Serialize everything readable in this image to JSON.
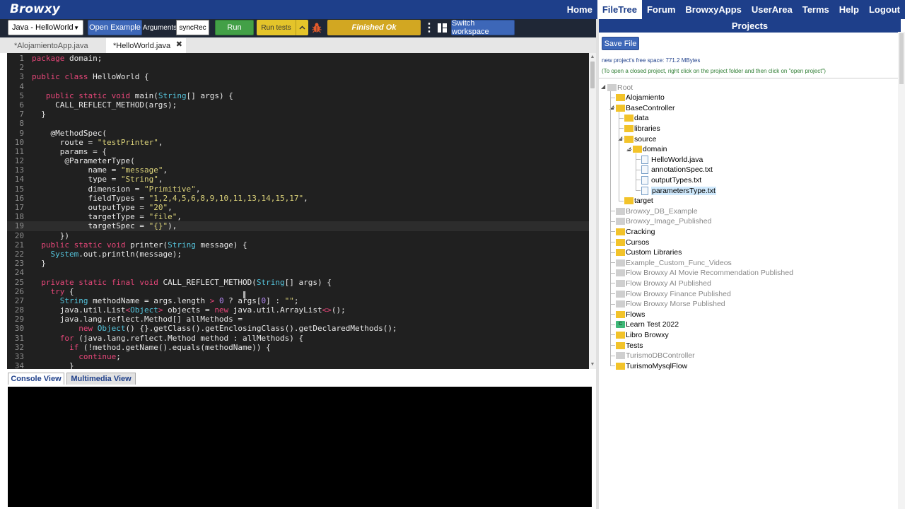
{
  "app": {
    "brand": "Browxy"
  },
  "nav": [
    "Home",
    "FileTree",
    "Forum",
    "BrowxyApps",
    "UserArea",
    "Terms",
    "Help",
    "Logout"
  ],
  "nav_active": "FileTree",
  "toolbar": {
    "language": "Java - HelloWorld",
    "open_example": "Open Example",
    "arguments_label": "Arguments",
    "arguments_value": "syncRec",
    "run": "Run",
    "run_tests": "Run tests",
    "status": "Finished Ok",
    "switch_workspace": "Switch workspace"
  },
  "tabs": [
    {
      "label": "*AlojamientoApp.java",
      "active": false
    },
    {
      "label": "*HelloWorld.java",
      "active": true
    }
  ],
  "editor": {
    "cursor_line": 19,
    "lines": [
      [
        [
          "kw",
          "package"
        ],
        [
          "t",
          " domain;"
        ]
      ],
      [],
      [
        [
          "kw",
          "public class"
        ],
        [
          "t",
          " HelloWorld {"
        ]
      ],
      [],
      [
        [
          "t",
          "   "
        ],
        [
          "kw",
          "public static void"
        ],
        [
          "t",
          " main("
        ],
        [
          "type",
          "String"
        ],
        [
          "t",
          "[] args) {"
        ]
      ],
      [
        [
          "t",
          "     CALL_REFLECT_METHOD(args);"
        ]
      ],
      [
        [
          "t",
          "  }"
        ]
      ],
      [],
      [
        [
          "t",
          "    @MethodSpec("
        ]
      ],
      [
        [
          "t",
          "      route = "
        ],
        [
          "str",
          "\"testPrinter\""
        ],
        [
          "t",
          ","
        ]
      ],
      [
        [
          "t",
          "      params = {"
        ]
      ],
      [
        [
          "t",
          "       @ParameterType("
        ]
      ],
      [
        [
          "t",
          "            name = "
        ],
        [
          "str",
          "\"message\""
        ],
        [
          "t",
          ","
        ]
      ],
      [
        [
          "t",
          "            type = "
        ],
        [
          "str",
          "\"String\""
        ],
        [
          "t",
          ","
        ]
      ],
      [
        [
          "t",
          "            dimension = "
        ],
        [
          "str",
          "\"Primitive\""
        ],
        [
          "t",
          ","
        ]
      ],
      [
        [
          "t",
          "            fieldTypes = "
        ],
        [
          "str",
          "\"1,2,4,5,6,8,9,10,11,13,14,15,17\""
        ],
        [
          "t",
          ","
        ]
      ],
      [
        [
          "t",
          "            outputType = "
        ],
        [
          "str",
          "\"20\""
        ],
        [
          "t",
          ","
        ]
      ],
      [
        [
          "t",
          "            targetType = "
        ],
        [
          "str",
          "\"file\""
        ],
        [
          "t",
          ","
        ]
      ],
      [
        [
          "t",
          "            targetSpec = "
        ],
        [
          "str",
          "\"{}\""
        ],
        [
          "t",
          "),"
        ]
      ],
      [
        [
          "t",
          "      })"
        ]
      ],
      [
        [
          "t",
          "  "
        ],
        [
          "kw",
          "public static void"
        ],
        [
          "t",
          " printer("
        ],
        [
          "type",
          "String"
        ],
        [
          "t",
          " message) {"
        ]
      ],
      [
        [
          "t",
          "    "
        ],
        [
          "type",
          "System"
        ],
        [
          "t",
          ".out.println(message);"
        ]
      ],
      [
        [
          "t",
          "  }"
        ]
      ],
      [],
      [
        [
          "t",
          "  "
        ],
        [
          "kw",
          "private static final void"
        ],
        [
          "t",
          " CALL_REFLECT_METHOD("
        ],
        [
          "type",
          "String"
        ],
        [
          "t",
          "[] args) {"
        ]
      ],
      [
        [
          "t",
          "    "
        ],
        [
          "kw",
          "try"
        ],
        [
          "t",
          " {"
        ]
      ],
      [
        [
          "t",
          "      "
        ],
        [
          "type",
          "String"
        ],
        [
          "t",
          " methodName = args.length "
        ],
        [
          "kw",
          ">"
        ],
        [
          "t",
          " "
        ],
        [
          "num",
          "0"
        ],
        [
          "t",
          " ? args["
        ],
        [
          "num",
          "0"
        ],
        [
          "t",
          "] : "
        ],
        [
          "str",
          "\"\""
        ],
        [
          "t",
          ";"
        ]
      ],
      [
        [
          "t",
          "      java.util.List"
        ],
        [
          "kw",
          "<"
        ],
        [
          "type",
          "Object"
        ],
        [
          "kw",
          ">"
        ],
        [
          "t",
          " objects = "
        ],
        [
          "kw",
          "new"
        ],
        [
          "t",
          " java.util.ArrayList"
        ],
        [
          "kw",
          "<>"
        ],
        [
          "t",
          "();"
        ]
      ],
      [
        [
          "t",
          "      java.lang.reflect.Method[] allMethods ="
        ]
      ],
      [
        [
          "t",
          "          "
        ],
        [
          "kw",
          "new"
        ],
        [
          "t",
          " "
        ],
        [
          "type",
          "Object"
        ],
        [
          "t",
          "() {}.getClass().getEnclosingClass().getDeclaredMethods();"
        ]
      ],
      [
        [
          "t",
          "      "
        ],
        [
          "kw",
          "for"
        ],
        [
          "t",
          " (java.lang.reflect.Method method : allMethods) {"
        ]
      ],
      [
        [
          "t",
          "        "
        ],
        [
          "kw",
          "if"
        ],
        [
          "t",
          " (!method.getName().equals(methodName)) {"
        ]
      ],
      [
        [
          "t",
          "          "
        ],
        [
          "kw",
          "continue"
        ],
        [
          "t",
          ";"
        ]
      ],
      [
        [
          "t",
          "        }"
        ]
      ]
    ]
  },
  "console": {
    "tabs": [
      "Console View",
      "Multimedia View"
    ],
    "active": "Console View"
  },
  "projects": {
    "title": "Projects",
    "save_file": "Save File",
    "free_space": "new project's free space: 771.2 MBytes",
    "hint": "(To open a closed project, right click on the project folder and then click on \"open project\")",
    "tree": [
      {
        "label": "Root",
        "depth": 0,
        "icon": "gray",
        "dim": true,
        "toggle": "open"
      },
      {
        "label": "Alojamiento",
        "depth": 1,
        "icon": "yellow",
        "dim": false
      },
      {
        "label": "BaseController",
        "depth": 1,
        "icon": "yellow",
        "dim": false,
        "toggle": "open"
      },
      {
        "label": "data",
        "depth": 2,
        "icon": "yellow",
        "dim": false
      },
      {
        "label": "libraries",
        "depth": 2,
        "icon": "yellow",
        "dim": false
      },
      {
        "label": "source",
        "depth": 2,
        "icon": "yellow",
        "dim": false,
        "toggle": "open"
      },
      {
        "label": "domain",
        "depth": 3,
        "icon": "yellow",
        "dim": false,
        "toggle": "open"
      },
      {
        "label": "HelloWorld.java",
        "depth": 4,
        "icon": "file",
        "dim": false
      },
      {
        "label": "annotationSpec.txt",
        "depth": 4,
        "icon": "file",
        "dim": false
      },
      {
        "label": "outputTypes.txt",
        "depth": 4,
        "icon": "file",
        "dim": false
      },
      {
        "label": "parametersType.txt",
        "depth": 4,
        "icon": "file",
        "dim": false,
        "selected": true
      },
      {
        "label": "target",
        "depth": 2,
        "icon": "yellow",
        "dim": false
      },
      {
        "label": "Browxy_DB_Example",
        "depth": 1,
        "icon": "gray",
        "dim": true
      },
      {
        "label": "Browxy_Image_Published",
        "depth": 1,
        "icon": "gray",
        "dim": true
      },
      {
        "label": "Cracking",
        "depth": 1,
        "icon": "yellow",
        "dim": false
      },
      {
        "label": "Cursos",
        "depth": 1,
        "icon": "yellow",
        "dim": false
      },
      {
        "label": "Custom Libraries",
        "depth": 1,
        "icon": "yellow",
        "dim": false
      },
      {
        "label": "Example_Custom_Func_Videos",
        "depth": 1,
        "icon": "gray",
        "dim": true
      },
      {
        "label": "Flow Browxy AI Movie Recommendation Published",
        "depth": 1,
        "icon": "gray",
        "dim": true
      },
      {
        "label": "Flow Browxy AI Published",
        "depth": 1,
        "icon": "gray",
        "dim": true
      },
      {
        "label": "Flow Browxy Finance Published",
        "depth": 1,
        "icon": "gray",
        "dim": true
      },
      {
        "label": "Flow Browxy Morse Published",
        "depth": 1,
        "icon": "gray",
        "dim": true
      },
      {
        "label": "Flows",
        "depth": 1,
        "icon": "yellow",
        "dim": false
      },
      {
        "label": "Learn Test 2022",
        "depth": 1,
        "icon": "special",
        "dim": false
      },
      {
        "label": "Libro Browxy",
        "depth": 1,
        "icon": "yellow",
        "dim": false
      },
      {
        "label": "Tests",
        "depth": 1,
        "icon": "yellow",
        "dim": false
      },
      {
        "label": "TurismoDBController",
        "depth": 1,
        "icon": "gray",
        "dim": true
      },
      {
        "label": "TurismoMysqlFlow",
        "depth": 1,
        "icon": "yellow",
        "dim": false
      }
    ]
  },
  "colors": {
    "nav_bg": "#1e3f8a",
    "editor_bg": "#202020",
    "keyword": "#e8477a",
    "string": "#dcd37a",
    "type": "#55c4dc",
    "status_bg": "#d2a722",
    "run_green": "#43a047"
  }
}
